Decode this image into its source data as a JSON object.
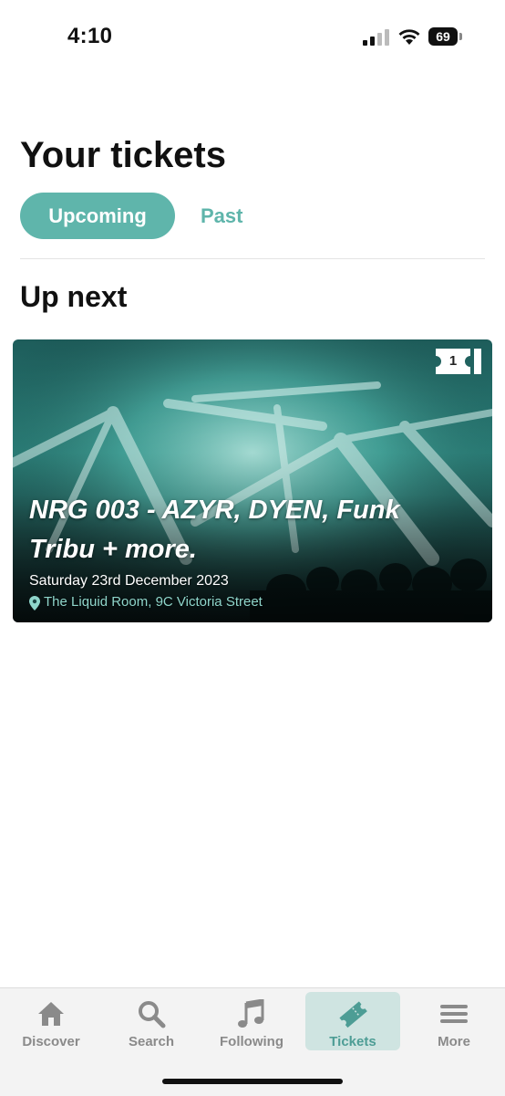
{
  "status_bar": {
    "time": "4:10",
    "battery": "69"
  },
  "header": {
    "title": "Your tickets",
    "tabs": [
      {
        "label": "Upcoming",
        "active": true
      },
      {
        "label": "Past",
        "active": false
      }
    ]
  },
  "main": {
    "section_title": "Up next",
    "event": {
      "title": "NRG 003 - AZYR, DYEN, Funk Tribu + more.",
      "date": "Saturday 23rd December 2023",
      "venue": "The Liquid Room, 9C Victoria Street",
      "ticket_count": "1"
    }
  },
  "bottom_nav": {
    "items": [
      {
        "label": "Discover",
        "icon": "home-icon",
        "active": false
      },
      {
        "label": "Search",
        "icon": "search-icon",
        "active": false
      },
      {
        "label": "Following",
        "icon": "music-note-icon",
        "active": false
      },
      {
        "label": "Tickets",
        "icon": "ticket-icon",
        "active": true
      },
      {
        "label": "More",
        "icon": "menu-icon",
        "active": false
      }
    ]
  },
  "colors": {
    "accent": "#5fb5ab",
    "nav_active_bg": "#cfe4e1",
    "nav_inactive": "#8a8a8a"
  }
}
